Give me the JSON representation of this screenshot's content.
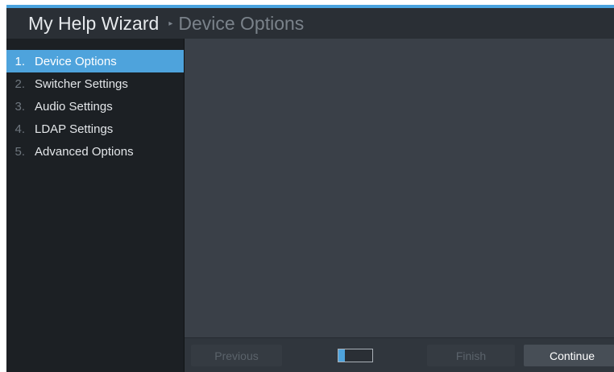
{
  "header": {
    "app_title": "My Help Wizard",
    "separator": "▸",
    "page_title": "Device Options"
  },
  "sidebar": {
    "steps": [
      {
        "number": "1.",
        "label": "Device Options",
        "active": true
      },
      {
        "number": "2.",
        "label": "Switcher Settings",
        "active": false
      },
      {
        "number": "3.",
        "label": "Audio Settings",
        "active": false
      },
      {
        "number": "4.",
        "label": "LDAP Settings",
        "active": false
      },
      {
        "number": "5.",
        "label": "Advanced Options",
        "active": false
      }
    ]
  },
  "footer": {
    "previous_label": "Previous",
    "finish_label": "Finish",
    "continue_label": "Continue",
    "progress_fraction": 0.2
  },
  "colors": {
    "accent": "#4ea3dc",
    "panel": "#3a4048",
    "sidebar": "#1c2024"
  }
}
